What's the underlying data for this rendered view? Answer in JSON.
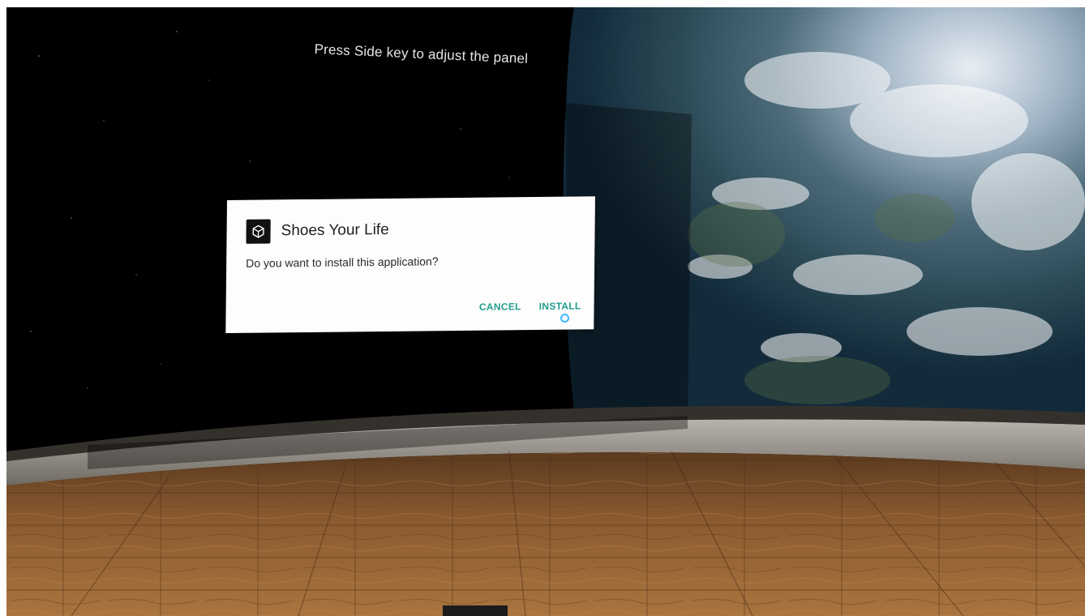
{
  "vr_environment": {
    "hint_text": "Press Side key to adjust the panel",
    "background": "earth-from-space",
    "floor": "wooden-floor"
  },
  "install_dialog": {
    "app_icon": "unity-logo-icon",
    "app_name": "Shoes Your Life",
    "message": "Do you want to install this application?",
    "cancel_label": "CANCEL",
    "install_label": "INSTALL"
  },
  "colors": {
    "accent": "#1f9c8c",
    "pointer": "#3cb8ff"
  }
}
